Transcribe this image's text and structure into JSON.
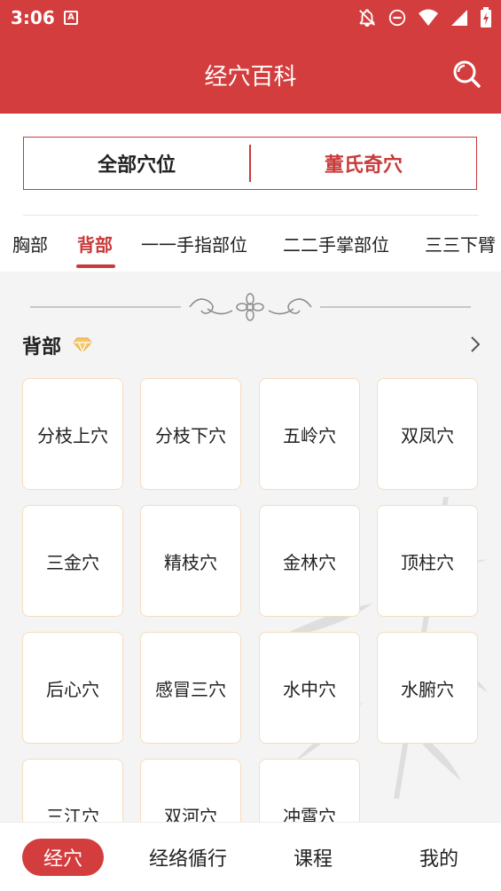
{
  "status_bar": {
    "time": "3:06",
    "left_icon": "a-letter-icon",
    "right_icons": [
      "notifications-off-icon",
      "do-not-disturb-icon",
      "wifi-icon",
      "signal-icon",
      "battery-charging-icon"
    ]
  },
  "app_bar": {
    "title": "经穴百科",
    "search_icon": "search-icon"
  },
  "segment": {
    "all_points": "全部穴位",
    "dong_points": "董氏奇穴"
  },
  "tabs": [
    {
      "label": "胸部",
      "active": false
    },
    {
      "label": "背部",
      "active": true
    },
    {
      "label": "一一手指部位",
      "active": false
    },
    {
      "label": "二二手掌部位",
      "active": false
    },
    {
      "label": "三三下臂",
      "active": false
    }
  ],
  "section": {
    "title": "背部",
    "badge_icon": "diamond-icon",
    "more_icon": "chevron-right-icon"
  },
  "points": [
    "分枝上穴",
    "分枝下穴",
    "五岭穴",
    "双凤穴",
    "三金穴",
    "精枝穴",
    "金林穴",
    "顶柱穴",
    "后心穴",
    "感冒三穴",
    "水中穴",
    "水腑穴",
    "三江穴",
    "双河穴",
    "冲霄穴"
  ],
  "bottom_nav": [
    {
      "label": "经穴",
      "active": true
    },
    {
      "label": "经络循行",
      "active": false
    },
    {
      "label": "课程",
      "active": false
    },
    {
      "label": "我的",
      "active": false
    }
  ],
  "colors": {
    "primary_red": "#d43d3d",
    "card_border": "#f6dcc0",
    "background": "#f4f4f4"
  }
}
